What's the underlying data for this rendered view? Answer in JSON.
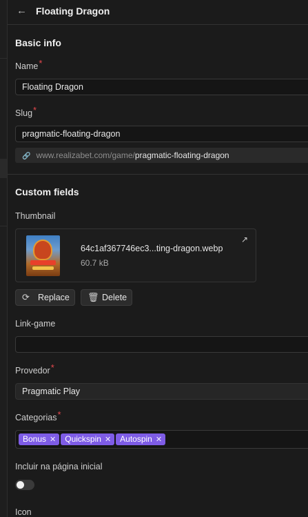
{
  "header": {
    "title": "Floating Dragon"
  },
  "basic_info": {
    "title": "Basic info",
    "name": {
      "label": "Name",
      "value": "Floating Dragon"
    },
    "slug": {
      "label": "Slug",
      "value": "pragmatic-floating-dragon"
    },
    "url": {
      "base": "www.realizabet.com/game/",
      "slug": "pragmatic-floating-dragon"
    }
  },
  "custom_fields": {
    "title": "Custom fields",
    "thumbnail": {
      "label": "Thumbnail",
      "file_name": "64c1af367746ec3...ting-dragon.webp",
      "file_size": "60.7 kB",
      "replace_label": "Replace",
      "delete_label": "Delete"
    },
    "link_game": {
      "label": "Link-game",
      "value": ""
    },
    "provedor": {
      "label": "Provedor",
      "value": "Pragmatic Play"
    },
    "categorias": {
      "label": "Categorias",
      "tags": [
        "Bonus",
        "Quickspin",
        "Autospin"
      ]
    },
    "incluir": {
      "label": "Incluir na página inicial",
      "checked": false
    },
    "icon": {
      "label": "Icon"
    }
  },
  "colors": {
    "accent_tag": "#7e5ce6",
    "required": "#e5484d"
  }
}
